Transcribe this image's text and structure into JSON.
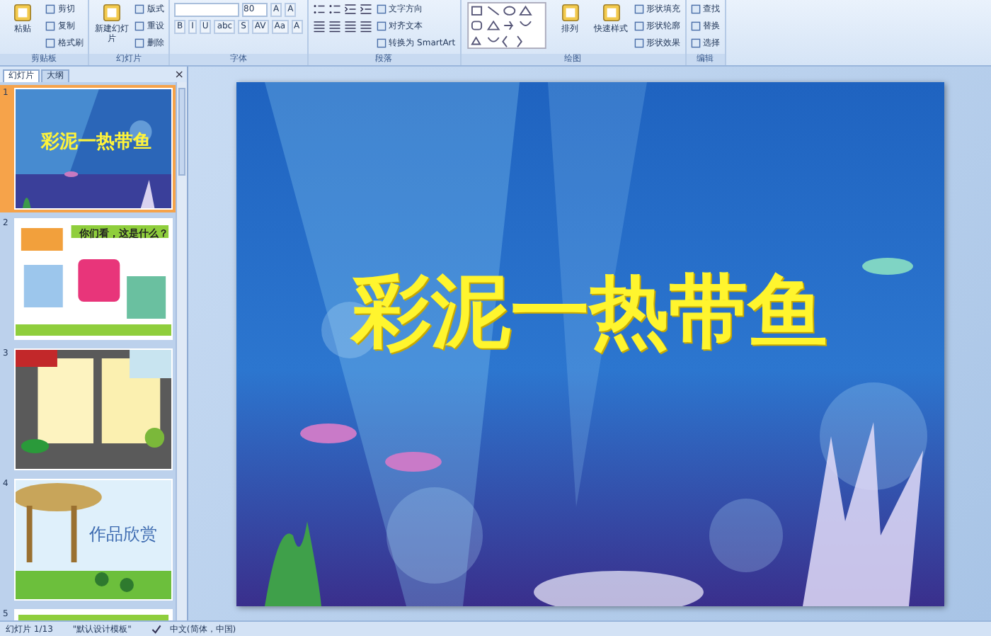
{
  "ribbon": {
    "groups": [
      {
        "title": "剪贴板",
        "items": [
          {
            "kind": "big",
            "label": "粘贴"
          },
          {
            "kind": "stack",
            "rows": [
              {
                "buttons": [
                  {
                    "kind": "small",
                    "label": "剪切"
                  }
                ]
              },
              {
                "buttons": [
                  {
                    "kind": "small",
                    "label": "复制"
                  }
                ]
              },
              {
                "buttons": [
                  {
                    "kind": "small",
                    "label": "格式刷"
                  }
                ]
              }
            ]
          }
        ]
      },
      {
        "title": "幻灯片",
        "items": [
          {
            "kind": "big",
            "label": "新建幻灯片"
          },
          {
            "kind": "stack",
            "rows": [
              {
                "buttons": [
                  {
                    "kind": "small",
                    "label": "版式"
                  }
                ]
              },
              {
                "buttons": [
                  {
                    "kind": "small",
                    "label": "重设"
                  }
                ]
              },
              {
                "buttons": [
                  {
                    "kind": "small",
                    "label": "删除"
                  }
                ]
              }
            ]
          }
        ]
      },
      {
        "title": "字体",
        "items": [
          {
            "kind": "stack",
            "rows": [
              {
                "buttons": [
                  {
                    "kind": "field"
                  },
                  {
                    "kind": "field",
                    "value": "80"
                  },
                  {
                    "kind": "glyph",
                    "label": "A"
                  },
                  {
                    "kind": "glyph",
                    "label": "A"
                  }
                ]
              },
              {
                "buttons": [
                  {
                    "kind": "glyph",
                    "label": "B"
                  },
                  {
                    "kind": "glyph",
                    "label": "I"
                  },
                  {
                    "kind": "glyph",
                    "label": "U"
                  },
                  {
                    "kind": "glyph",
                    "label": "abc"
                  },
                  {
                    "kind": "glyph",
                    "label": "S"
                  },
                  {
                    "kind": "glyph",
                    "label": "AV"
                  },
                  {
                    "kind": "glyph",
                    "label": "Aa"
                  },
                  {
                    "kind": "glyph",
                    "label": "A"
                  }
                ]
              }
            ]
          }
        ]
      },
      {
        "title": "段落",
        "items": [
          {
            "kind": "stack",
            "rows": [
              {
                "buttons": [
                  {
                    "kind": "list"
                  },
                  {
                    "kind": "list"
                  },
                  {
                    "kind": "indent"
                  },
                  {
                    "kind": "indent"
                  }
                ]
              },
              {
                "buttons": [
                  {
                    "kind": "align"
                  },
                  {
                    "kind": "align"
                  },
                  {
                    "kind": "align"
                  },
                  {
                    "kind": "align"
                  }
                ]
              }
            ]
          },
          {
            "kind": "stack",
            "rows": [
              {
                "buttons": [
                  {
                    "kind": "small",
                    "label": "文字方向"
                  }
                ]
              },
              {
                "buttons": [
                  {
                    "kind": "small",
                    "label": "对齐文本"
                  }
                ]
              },
              {
                "buttons": [
                  {
                    "kind": "small",
                    "label": "转换为 SmartArt"
                  }
                ]
              }
            ]
          }
        ]
      },
      {
        "title": "绘图",
        "items": [
          {
            "kind": "gallery"
          },
          {
            "kind": "big",
            "label": "排列"
          },
          {
            "kind": "big",
            "label": "快速样式"
          },
          {
            "kind": "stack",
            "rows": [
              {
                "buttons": [
                  {
                    "kind": "small",
                    "label": "形状填充"
                  }
                ]
              },
              {
                "buttons": [
                  {
                    "kind": "small",
                    "label": "形状轮廓"
                  }
                ]
              },
              {
                "buttons": [
                  {
                    "kind": "small",
                    "label": "形状效果"
                  }
                ]
              }
            ]
          }
        ]
      },
      {
        "title": "编辑",
        "items": [
          {
            "kind": "stack",
            "rows": [
              {
                "buttons": [
                  {
                    "kind": "small",
                    "label": "查找"
                  }
                ]
              },
              {
                "buttons": [
                  {
                    "kind": "small",
                    "label": "替换"
                  }
                ]
              },
              {
                "buttons": [
                  {
                    "kind": "small",
                    "label": "选择"
                  }
                ]
              }
            ]
          }
        ]
      }
    ]
  },
  "panel": {
    "tabs": [
      {
        "label": "幻灯片",
        "selected": true
      },
      {
        "label": "大纲",
        "selected": false
      }
    ],
    "close": "×",
    "slides": [
      {
        "number": "1",
        "kind": "ocean",
        "title": "彩泥一热带鱼",
        "selected": true
      },
      {
        "number": "2",
        "kind": "toys",
        "title": "你们看，这是什么？",
        "selected": false
      },
      {
        "number": "3",
        "kind": "board",
        "selected": false
      },
      {
        "number": "4",
        "kind": "garden",
        "title": "作品欣赏",
        "selected": false
      },
      {
        "number": "5",
        "kind": "partial",
        "selected": false
      }
    ]
  },
  "slide": {
    "title": "彩泥一热带鱼"
  },
  "status_bar": {
    "position": "幻灯片 1/13",
    "theme": "\"默认设计模板\"",
    "language": "中文(简体，中国)"
  }
}
